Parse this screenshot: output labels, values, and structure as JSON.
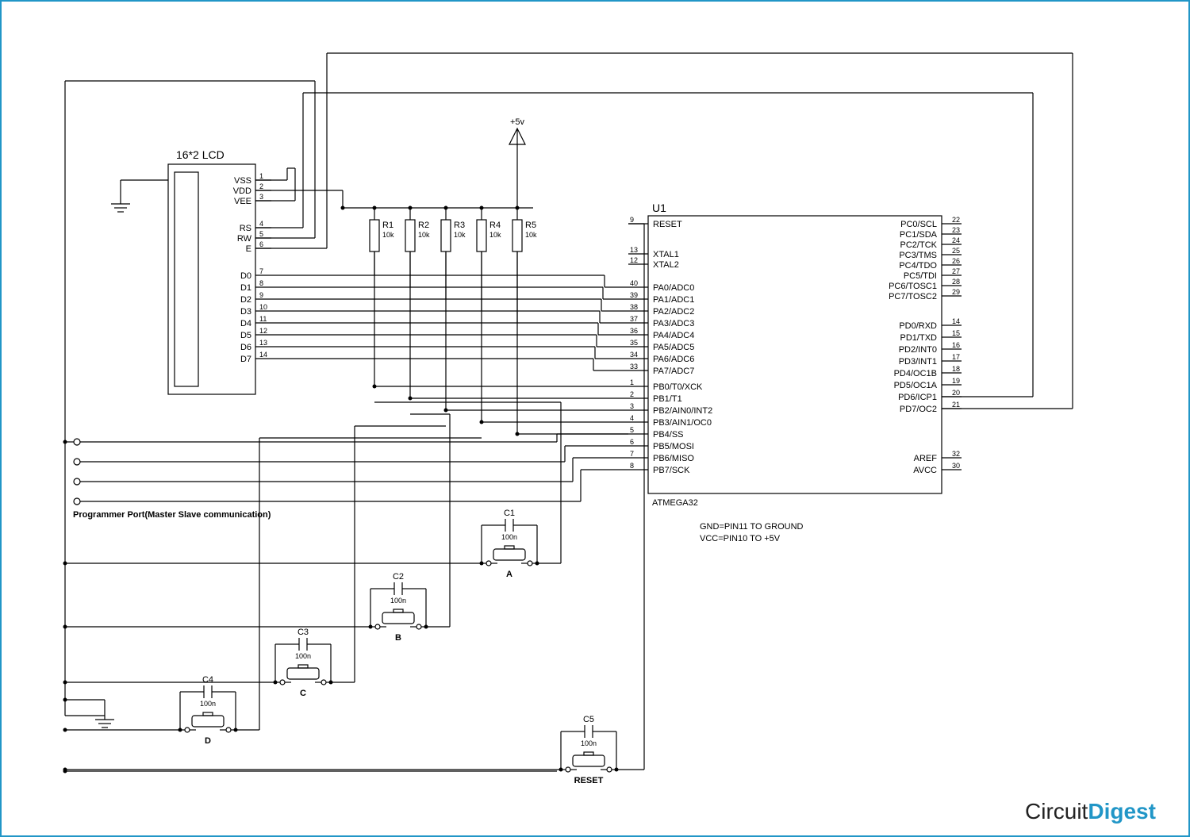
{
  "lcd": {
    "title": "16*2 LCD",
    "pins_top": [
      {
        "n": "1",
        "l": "VSS"
      },
      {
        "n": "2",
        "l": "VDD"
      },
      {
        "n": "3",
        "l": "VEE"
      }
    ],
    "pins_mid": [
      {
        "n": "4",
        "l": "RS"
      },
      {
        "n": "5",
        "l": "RW"
      },
      {
        "n": "6",
        "l": "E"
      }
    ],
    "pins_data": [
      {
        "n": "7",
        "l": "D0"
      },
      {
        "n": "8",
        "l": "D1"
      },
      {
        "n": "9",
        "l": "D2"
      },
      {
        "n": "10",
        "l": "D3"
      },
      {
        "n": "11",
        "l": "D4"
      },
      {
        "n": "12",
        "l": "D5"
      },
      {
        "n": "13",
        "l": "D6"
      },
      {
        "n": "14",
        "l": "D7"
      }
    ]
  },
  "power": {
    "label": "+5v"
  },
  "resistors": [
    {
      "ref": "R1",
      "val": "10k"
    },
    {
      "ref": "R2",
      "val": "10k"
    },
    {
      "ref": "R3",
      "val": "10k"
    },
    {
      "ref": "R4",
      "val": "10k"
    },
    {
      "ref": "R5",
      "val": "10k"
    }
  ],
  "mcu": {
    "ref": "U1",
    "part": "ATMEGA32",
    "left": [
      {
        "n": "9",
        "l": "RESET"
      },
      {
        "n": "13",
        "l": "XTAL1"
      },
      {
        "n": "12",
        "l": "XTAL2"
      },
      {
        "n": "40",
        "l": "PA0/ADC0"
      },
      {
        "n": "39",
        "l": "PA1/ADC1"
      },
      {
        "n": "38",
        "l": "PA2/ADC2"
      },
      {
        "n": "37",
        "l": "PA3/ADC3"
      },
      {
        "n": "36",
        "l": "PA4/ADC4"
      },
      {
        "n": "35",
        "l": "PA5/ADC5"
      },
      {
        "n": "34",
        "l": "PA6/ADC6"
      },
      {
        "n": "33",
        "l": "PA7/ADC7"
      },
      {
        "n": "1",
        "l": "PB0/T0/XCK"
      },
      {
        "n": "2",
        "l": "PB1/T1"
      },
      {
        "n": "3",
        "l": "PB2/AIN0/INT2"
      },
      {
        "n": "4",
        "l": "PB3/AIN1/OC0"
      },
      {
        "n": "5",
        "l": "PB4/SS"
      },
      {
        "n": "6",
        "l": "PB5/MOSI"
      },
      {
        "n": "7",
        "l": "PB6/MISO"
      },
      {
        "n": "8",
        "l": "PB7/SCK"
      }
    ],
    "right": [
      {
        "n": "22",
        "l": "PC0/SCL"
      },
      {
        "n": "23",
        "l": "PC1/SDA"
      },
      {
        "n": "24",
        "l": "PC2/TCK"
      },
      {
        "n": "25",
        "l": "PC3/TMS"
      },
      {
        "n": "26",
        "l": "PC4/TDO"
      },
      {
        "n": "27",
        "l": "PC5/TDI"
      },
      {
        "n": "28",
        "l": "PC6/TOSC1"
      },
      {
        "n": "29",
        "l": "PC7/TOSC2"
      },
      {
        "n": "14",
        "l": "PD0/RXD"
      },
      {
        "n": "15",
        "l": "PD1/TXD"
      },
      {
        "n": "16",
        "l": "PD2/INT0"
      },
      {
        "n": "17",
        "l": "PD3/INT1"
      },
      {
        "n": "18",
        "l": "PD4/OC1B"
      },
      {
        "n": "19",
        "l": "PD5/OC1A"
      },
      {
        "n": "20",
        "l": "PD6/ICP1"
      },
      {
        "n": "21",
        "l": "PD7/OC2"
      },
      {
        "n": "32",
        "l": "AREF"
      },
      {
        "n": "30",
        "l": "AVCC"
      }
    ]
  },
  "notes": {
    "gnd": "GND=PIN11 TO GROUND",
    "vcc": "VCC=PIN10 TO +5V"
  },
  "caps_buttons": [
    {
      "ref": "C1",
      "val": "100n",
      "btn": "A"
    },
    {
      "ref": "C2",
      "val": "100n",
      "btn": "B"
    },
    {
      "ref": "C3",
      "val": "100n",
      "btn": "C"
    },
    {
      "ref": "C4",
      "val": "100n",
      "btn": "D"
    },
    {
      "ref": "C5",
      "val": "100n",
      "btn": "RESET"
    }
  ],
  "prog_port": "Programmer Port(Master Slave communication)",
  "brand": {
    "p1": "Circuit",
    "p2": "Digest"
  }
}
